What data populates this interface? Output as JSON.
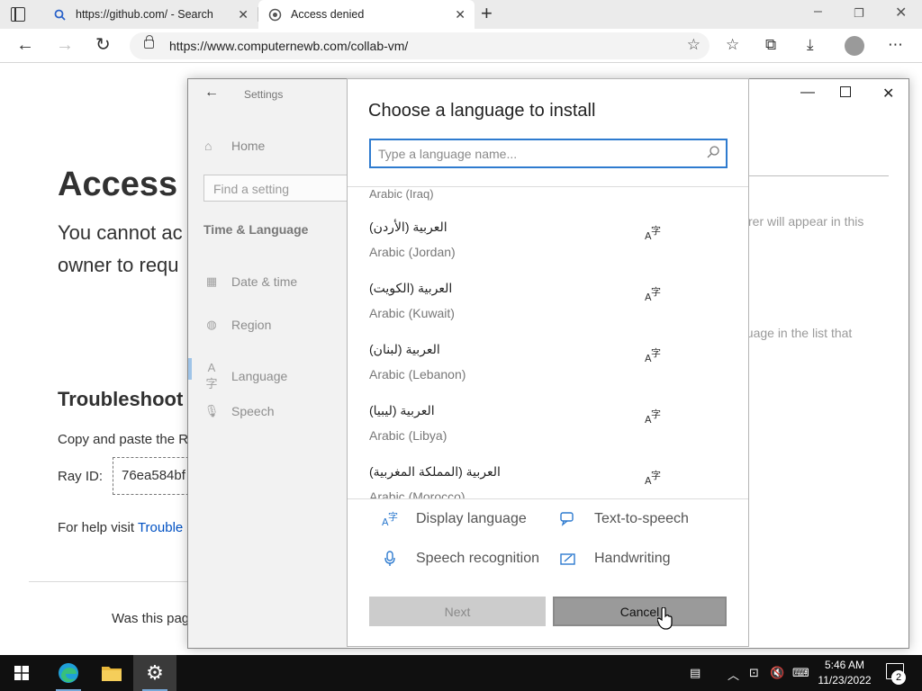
{
  "browser": {
    "tabs": [
      {
        "title": "https://github.com/ - Search",
        "icon": "search-icon",
        "active": false
      },
      {
        "title": "Access denied",
        "icon": "page-icon",
        "active": true
      }
    ],
    "url": "https://www.computernewb.com/collab-vm/"
  },
  "webpage": {
    "title": "Access d",
    "subtitle_line1": "You cannot ac",
    "subtitle_line2": "owner to requ",
    "troubleshoot_heading": "Troubleshoot",
    "copy_text": "Copy and paste the R",
    "ray_label": "Ray ID:",
    "ray_value": "76ea584bf",
    "help_text": "For help visit ",
    "help_link": "Trouble",
    "was_this": "Was this pag"
  },
  "settings": {
    "window_title": "Settings",
    "home": "Home",
    "find_placeholder": "Find a setting",
    "section": "Time & Language",
    "nav": [
      {
        "label": "Date & time",
        "icon": "calendar-clock-icon"
      },
      {
        "label": "Region",
        "icon": "globe-icon"
      },
      {
        "label": "Language",
        "icon": "language-icon",
        "selected": true
      },
      {
        "label": "Speech",
        "icon": "microphone-icon"
      }
    ],
    "right_text1": "rer will appear in this",
    "right_text2": "guage in the list that"
  },
  "dialog": {
    "title": "Choose a language to install",
    "search_placeholder": "Type a language name...",
    "partial_top": "Arabic (Iraq)",
    "languages": [
      {
        "native": "العربية (الأردن)",
        "english": "Arabic (Jordan)"
      },
      {
        "native": "العربية (الكويت)",
        "english": "Arabic (Kuwait)"
      },
      {
        "native": "العربية (لبنان)",
        "english": "Arabic (Lebanon)"
      },
      {
        "native": "العربية (ليبيا)",
        "english": "Arabic (Libya)"
      },
      {
        "native": "العربية (المملكة المغربية)",
        "english": "Arabic (Morocco)"
      }
    ],
    "features": [
      {
        "label": "Display language",
        "icon": "display-language-icon"
      },
      {
        "label": "Text-to-speech",
        "icon": "text-to-speech-icon"
      },
      {
        "label": "Speech recognition",
        "icon": "microphone-icon"
      },
      {
        "label": "Handwriting",
        "icon": "handwriting-icon"
      }
    ],
    "next_label": "Next",
    "cancel_label": "Cancel"
  },
  "taskbar": {
    "time": "5:46 AM",
    "date": "11/23/2022",
    "notification_count": "2"
  },
  "colors": {
    "accent": "#2e7bcf",
    "taskbar": "#101010",
    "link": "#0051c3"
  }
}
